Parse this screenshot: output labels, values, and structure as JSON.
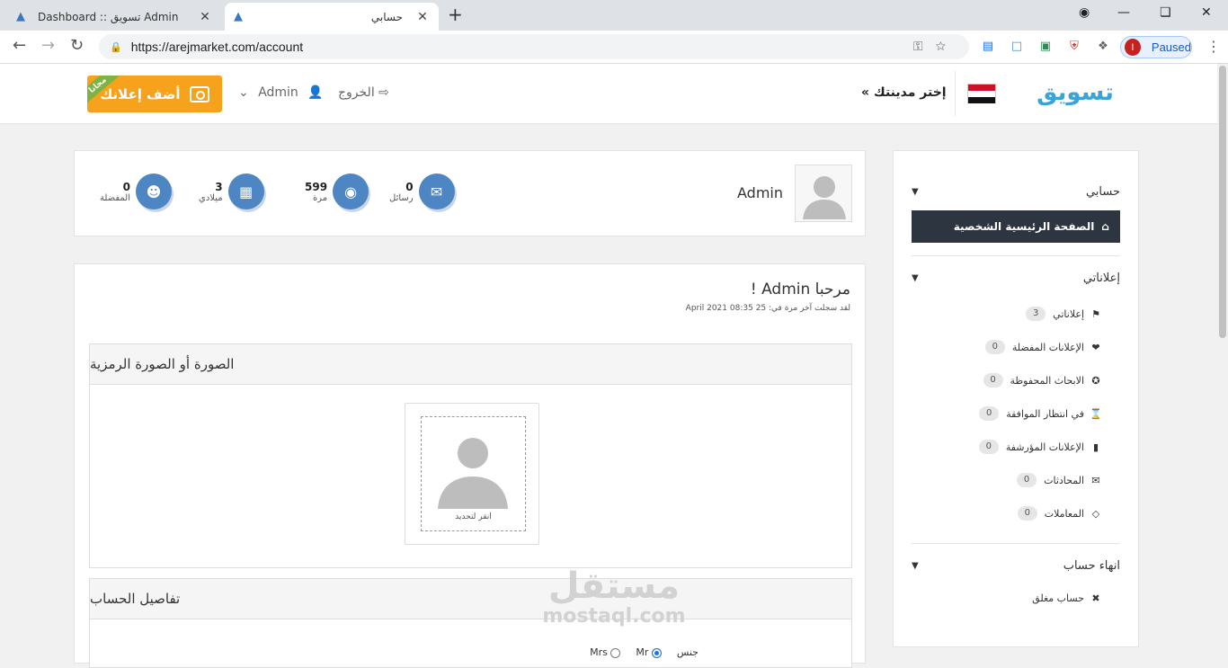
{
  "browser": {
    "tabs": [
      {
        "label": "Dashboard :: تسويق Admin",
        "active": false
      },
      {
        "label": "حسابي",
        "active": true
      }
    ],
    "url": "https://arejmarket.com/account",
    "profile_initial": "I",
    "profile_status": "Paused"
  },
  "header": {
    "city_prompt": "إختر مدينتك »",
    "logout_label": "الخروج",
    "admin_label": "Admin",
    "add_ad_label": "أضف إعلانك",
    "free_ribbon": "مجانا",
    "logo_text": "تسويق"
  },
  "profile": {
    "name": "Admin",
    "stats": [
      {
        "value": "0",
        "label": "رسائل",
        "icon": "envelope-icon"
      },
      {
        "value": "599",
        "label": "مرة",
        "icon": "eye-icon"
      },
      {
        "value": "3",
        "label": "ميلادي",
        "icon": "grid-icon"
      },
      {
        "value": "0",
        "label": "المفضلة",
        "icon": "user-icon"
      }
    ]
  },
  "main": {
    "welcome": "مرحبا Admin !",
    "last_login": "لقد سجلت آخر مرة في: 25 April 2021 08:35",
    "photo_section_title": "الصورة أو الصورة الرمزية",
    "click_to_select": "انقر لتحديد",
    "account_details_title": "تفاصيل الحساب",
    "gender_label": "جنس",
    "gender_options": [
      "Mr",
      "Mrs"
    ]
  },
  "sidebar": {
    "my_account": "حسابي",
    "home_item": "الصفحة الرئيسية الشخصية",
    "my_ads_section": "إعلاناتي",
    "items": [
      {
        "label": "إعلاناتي",
        "count": "3",
        "icon": "tag-icon"
      },
      {
        "label": "الإعلانات المفضلة",
        "count": "0",
        "icon": "heart-icon"
      },
      {
        "label": "الابحاث المحفوظة",
        "count": "0",
        "icon": "star-icon"
      },
      {
        "label": "في انتظار الموافقة",
        "count": "0",
        "icon": "hourglass-icon"
      },
      {
        "label": "الإعلانات المؤرشفة",
        "count": "0",
        "icon": "folder-icon"
      },
      {
        "label": "المحادثات",
        "count": "0",
        "icon": "mail-icon"
      },
      {
        "label": "المعاملات",
        "count": "0",
        "icon": "ticket-icon"
      }
    ],
    "close_section": "انهاء حساب",
    "closed_account": "حساب مغلق"
  },
  "watermark": {
    "line1": "مستقل",
    "line2": "mostaql.com"
  },
  "colors": {
    "accent": "#f6a21d",
    "stat_blue": "#4d86c2",
    "sidebar_active": "#2c3540"
  }
}
